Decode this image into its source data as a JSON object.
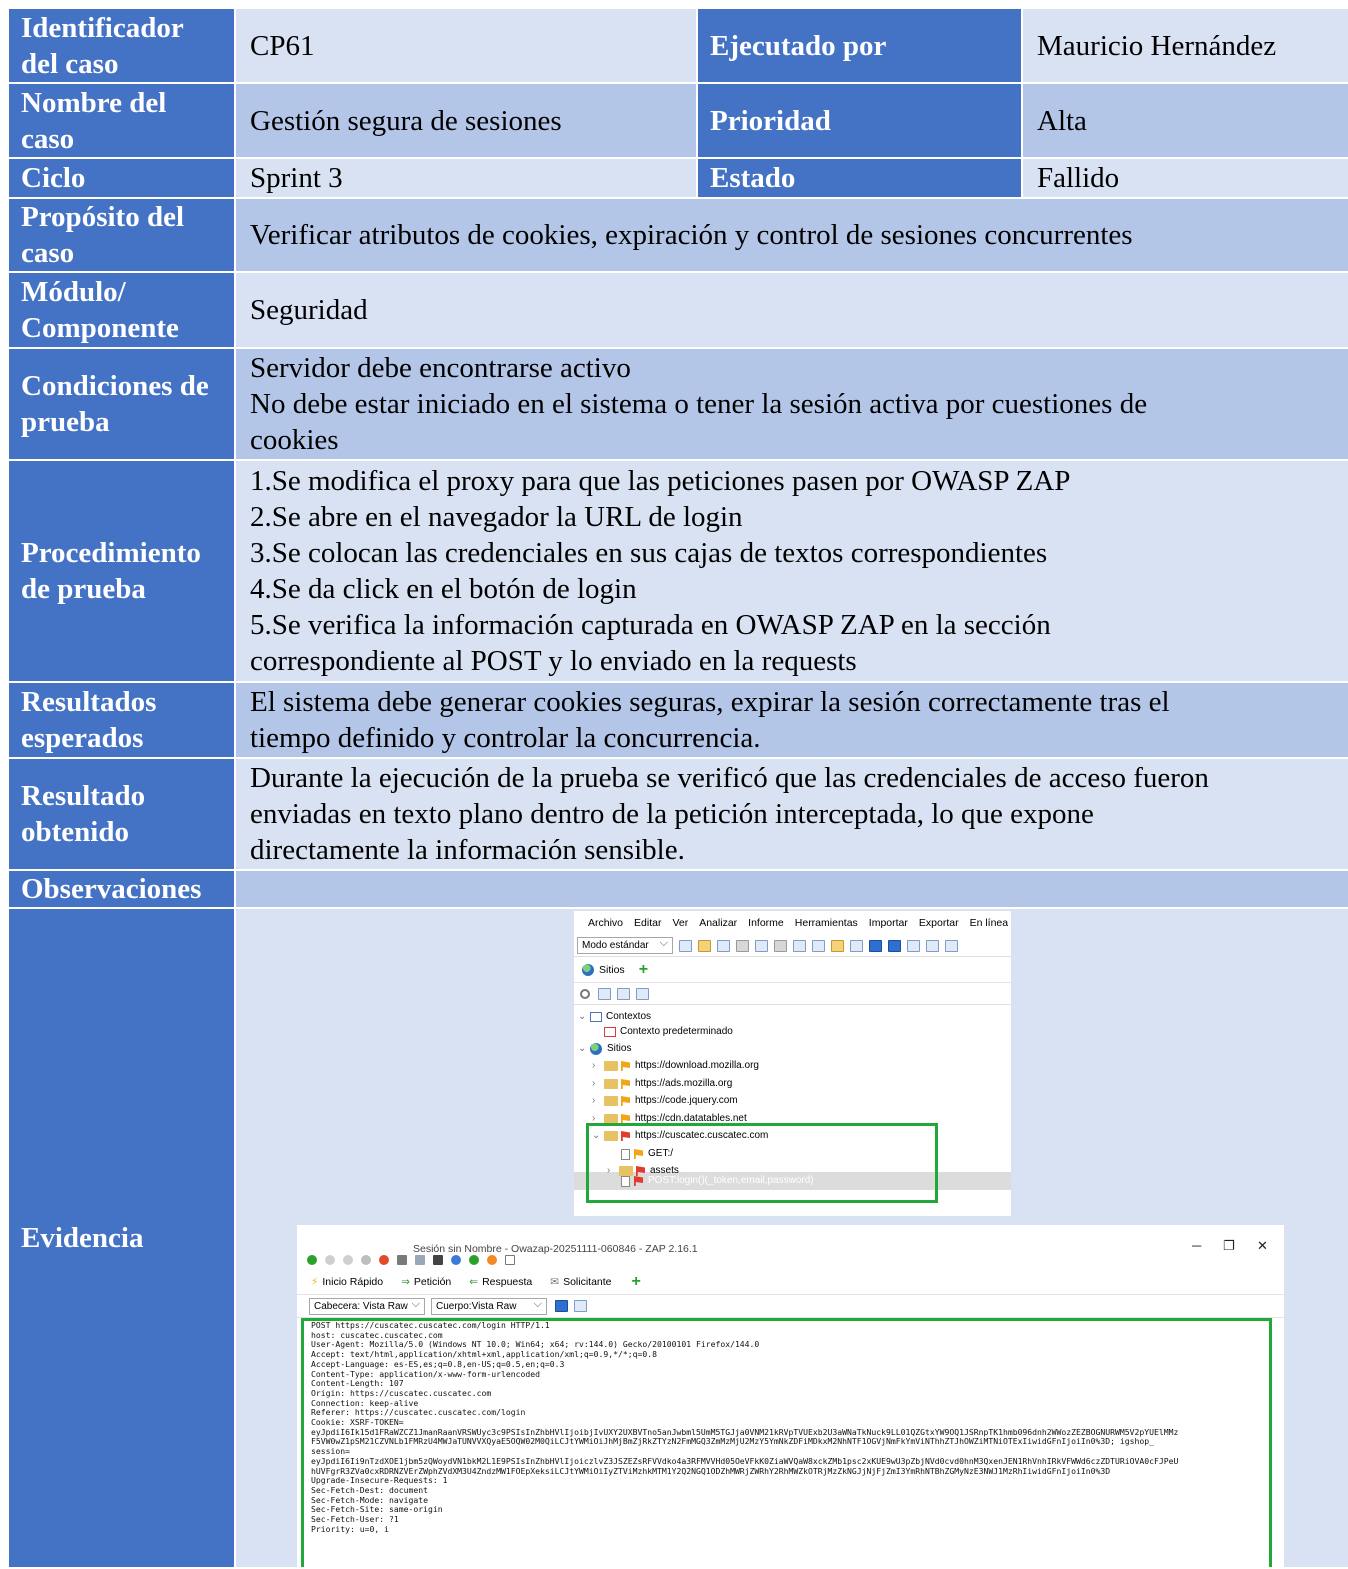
{
  "rows": {
    "identificador": {
      "label": "Identificador del caso",
      "value": "CP61"
    },
    "ejecutado": {
      "label": "Ejecutado por",
      "value": "Mauricio Hernández"
    },
    "nombre": {
      "label": "Nombre del caso",
      "value": "Gestión segura de sesiones"
    },
    "prioridad": {
      "label": "Prioridad",
      "value": "Alta"
    },
    "ciclo": {
      "label": "Ciclo",
      "value": "Sprint 3"
    },
    "estado": {
      "label": "Estado",
      "value": "Fallido"
    },
    "proposito": {
      "label": "Propósito del caso",
      "value": "Verificar atributos de cookies, expiración y control de sesiones concurrentes"
    },
    "modulo": {
      "label": "Módulo/ Componente",
      "value": "Seguridad"
    },
    "condiciones": {
      "label": "Condiciones de prueba",
      "lines": [
        "Servidor debe encontrarse activo",
        "No debe estar iniciado en el sistema o tener la sesión activa por cuestiones de",
        "cookies"
      ]
    },
    "procedimiento": {
      "label": "Procedimiento de prueba",
      "lines": [
        "1.Se modifica el proxy para que las peticiones pasen por OWASP ZAP",
        "2.Se abre en el navegador la URL de login",
        "3.Se colocan las credenciales en sus cajas de textos correspondientes",
        "4.Se da click en el botón de login",
        "5.Se verifica la información capturada en OWASP ZAP en la sección",
        "correspondiente al POST y lo enviado en la requests"
      ]
    },
    "esperados": {
      "label": "Resultados esperados",
      "lines": [
        "El sistema debe generar cookies seguras, expirar la sesión correctamente tras el",
        "tiempo definido y controlar la concurrencia."
      ]
    },
    "obtenido": {
      "label": "Resultado obtenido",
      "lines": [
        "Durante la ejecución de la prueba se verificó que las credenciales de acceso fueron",
        "enviadas en texto plano dentro de la petición interceptada, lo que expone",
        "directamente la información sensible."
      ]
    },
    "observaciones": {
      "label": "Observaciones",
      "value": ""
    },
    "evidencia": {
      "label": "Evidencia"
    }
  },
  "zap_sites": {
    "menu": [
      "Archivo",
      "Editar",
      "Ver",
      "Analizar",
      "Informe",
      "Herramientas",
      "Importar",
      "Exportar",
      "En línea"
    ],
    "mode": "Modo estándar",
    "tab": "Sitios",
    "tree": {
      "contexts": "Contextos",
      "default_context": "Contexto predeterminado",
      "sites": "Sitios",
      "items": [
        "https://download.mozilla.org",
        "https://ads.mozilla.org",
        "https://code.jquery.com",
        "https://cdn.datatables.net",
        "https://cuscatec.cuscatec.com"
      ],
      "children": [
        "GET:/",
        "assets",
        "POST:login()(_token,email,password)"
      ]
    }
  },
  "zap_request": {
    "window_title": "Sesión sin Nombre - Owazap-20251111-060846 - ZAP 2.16.1",
    "tabs": [
      "Inicio Rápido",
      "Petición",
      "Respuesta",
      "Solicitante"
    ],
    "header_view": "Cabecera: Vista Raw",
    "body_view": "Cuerpo:Vista Raw",
    "raw_lines": [
      "POST https://cuscatec.cuscatec.com/login HTTP/1.1",
      "host: cuscatec.cuscatec.com",
      "User-Agent: Mozilla/5.0 (Windows NT 10.0; Win64; x64; rv:144.0) Gecko/20100101 Firefox/144.0",
      "Accept: text/html,application/xhtml+xml,application/xml;q=0.9,*/*;q=0.8",
      "Accept-Language: es-ES,es;q=0.8,en-US;q=0.5,en;q=0.3",
      "Content-Type: application/x-www-form-urlencoded",
      "Content-Length: 107",
      "Origin: https://cuscatec.cuscatec.com",
      "Connection: keep-alive",
      "Referer: https://cuscatec.cuscatec.com/login",
      "Cookie: XSRF-TOKEN=",
      "eyJpdiI6Ik15d1FRaWZCZ1JmanRaanVRSWUyc3c9PSIsInZhbHVlIjoibjIvUXY2UXBVTno5anJwbml5UmM5TGJja0VNM21kRVpTVUExb2U3aWNaTkNuck9LL01QZGtxYW9OQ1JSRnpTK1hmb096dnh2WWozZEZBOGNURWM5V2pYUElMMz",
      "F5VW0wZ1pSM21CZVNLb1FMRzU4MWJaTUNVVXQyaE5OQW02M0QiLCJtYWMiOiJhMjBmZjRkZTYzN2FmMGQ3ZmMzMjU2MzY5YmNkZDFiMDkxM2NhNTF1OGVjNmFkYmViNThhZTJhOWZiMTNiOTExIiwidGFnIjoiIn0%3D; igshop_",
      "session=",
      "eyJpdiI6Ii9nTzdXOE1jbm5zQWoydVN1bkM2L1E9PSIsInZhbHVlIjoiczlvZ3JSZEZsRFVVdko4a3RFMVVHd05OeVFkK0ZiaWVQaW8xckZMb1psc2xKUE9wU3pZbjNVd0cvd0hnM3QxenJEN1RhVnhIRkVFWWd6czZDTURiOVA0cFJPeU",
      "hUVFgrR3ZVa0cxRDRNZVErZWphZVdXM3U4ZndzMW1FOEpXeksiLCJtYWMiOiIyZTViMzhkMTM1Y2Q2NGQ1ODZhMWRjZWRhY2RhMWZkOTRjMzZkNGJjNjFjZmI3YmRhNTBhZGMyNzE3NWJ1MzRhIiwidGFnIjoiIn0%3D",
      "Upgrade-Insecure-Requests: 1",
      "Sec-Fetch-Dest: document",
      "Sec-Fetch-Mode: navigate",
      "Sec-Fetch-Site: same-origin",
      "Sec-Fetch-User: ?1",
      "Priority: u=0, i"
    ]
  },
  "colors": {
    "header": "#4472c4",
    "row_light": "#d9e2f3",
    "row_dark": "#b4c6e7",
    "highlight": "#23a73a"
  }
}
